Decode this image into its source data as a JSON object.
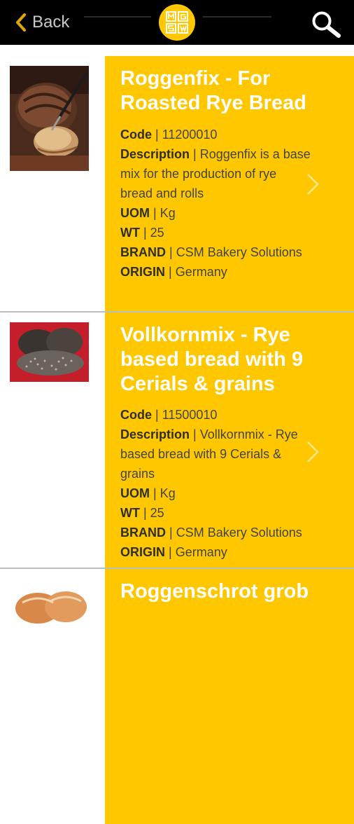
{
  "header": {
    "back_label": "Back",
    "logo_letters": "MGSW"
  },
  "colors": {
    "accent": "#ffc700",
    "topbar": "#000000",
    "title_text": "#ffffff"
  },
  "products": [
    {
      "title_line1": "Roggenfix - For",
      "title_line2": "Roasted Rye Bread",
      "code_label": "Code",
      "code": "11200010",
      "description_label": "Description",
      "description_line1": "Roggenfix is a base",
      "description_line2": "mix for the production of rye",
      "description_line3": "bread and rolls",
      "uom_label": "UOM",
      "uom": "Kg",
      "wt_label": "WT",
      "wt": "25",
      "brand_label": "BRAND",
      "brand": "CSM Bakery Solutions",
      "origin_label": "ORIGIN",
      "origin": "Germany",
      "image": "rye-bread-loaf"
    },
    {
      "title_line1": "Vollkornmix - Rye",
      "title_line2": "based bread with 9",
      "title_line3": "Cerials & grains",
      "code_label": "Code",
      "code": "11500010",
      "description_label": "Description",
      "description_line1": "Vollkornmix - Rye",
      "description_line2": "based bread with 9 Cerials &",
      "description_line3": "grains",
      "uom_label": "UOM",
      "uom": "Kg",
      "wt_label": "WT",
      "wt": "25",
      "brand_label": "BRAND",
      "brand": "CSM Bakery Solutions",
      "origin_label": "ORIGIN",
      "origin": "Germany",
      "image": "seeded-loaves"
    },
    {
      "title_line1": "Roggenschrot grob",
      "image": "rolls"
    }
  ]
}
